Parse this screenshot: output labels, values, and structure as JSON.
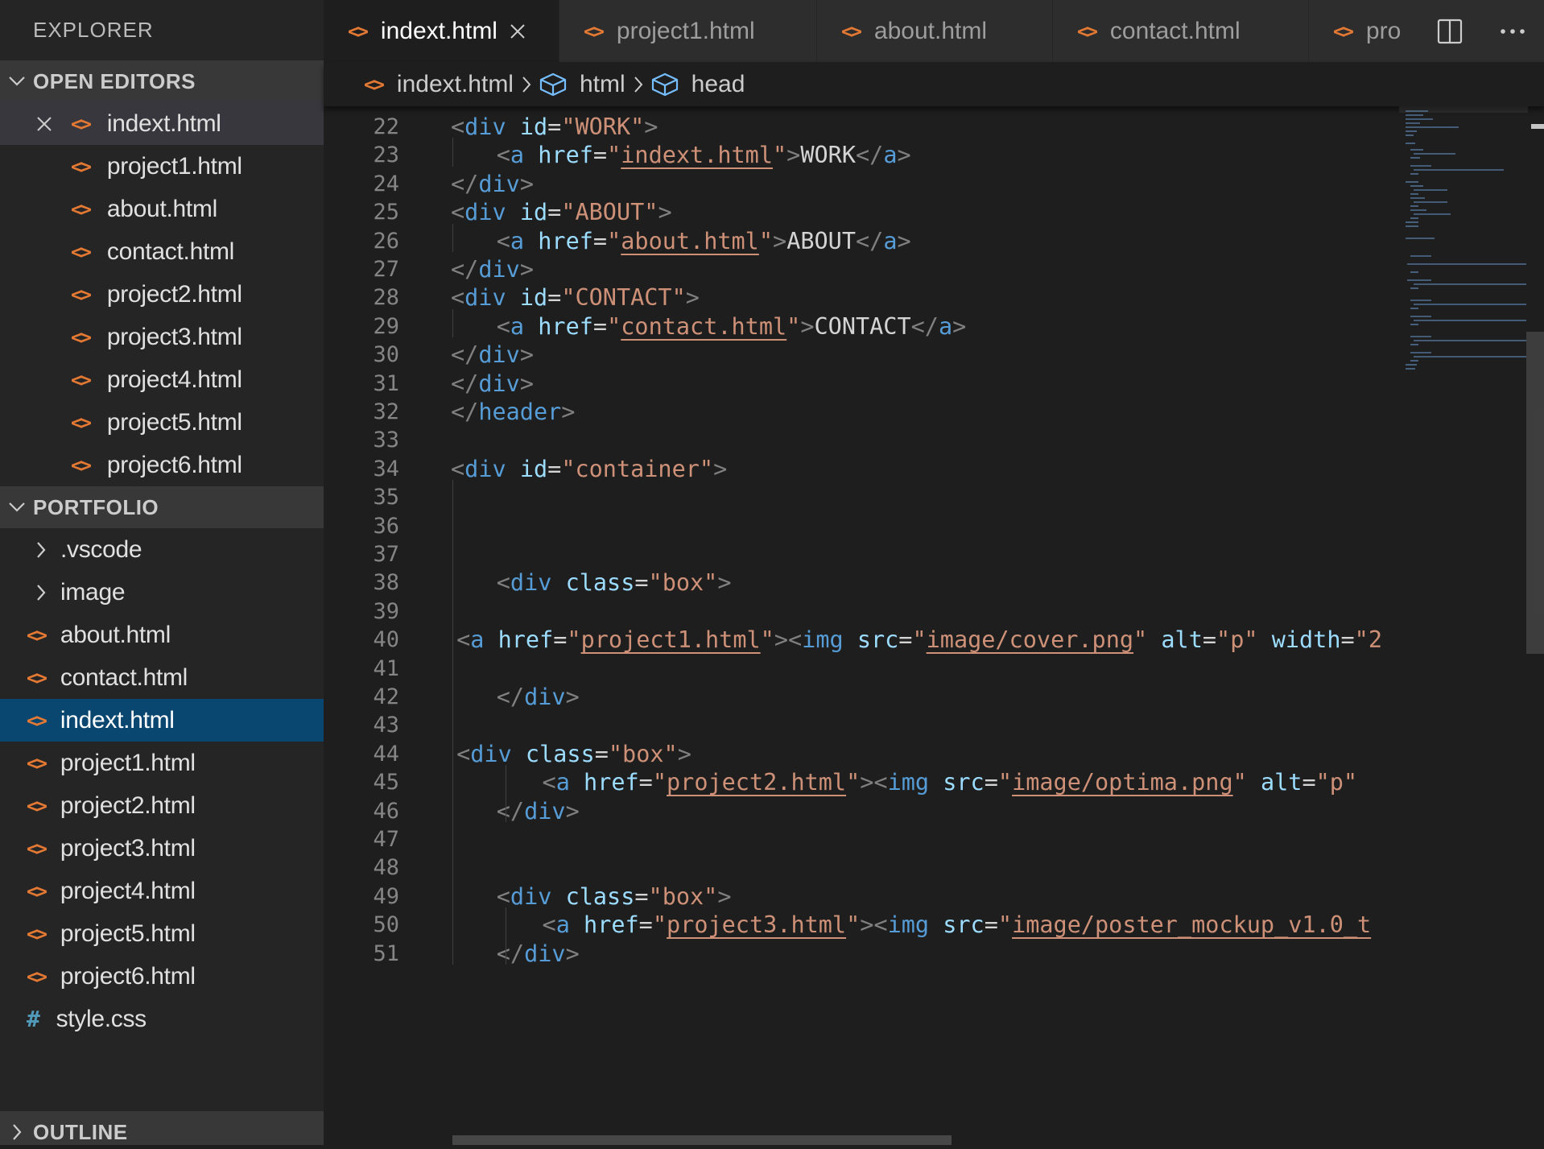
{
  "sidebar": {
    "title": "EXPLORER",
    "open_editors": {
      "label": "OPEN EDITORS",
      "items": [
        {
          "name": "indext.html",
          "active": true
        },
        {
          "name": "project1.html"
        },
        {
          "name": "about.html"
        },
        {
          "name": "contact.html"
        },
        {
          "name": "project2.html"
        },
        {
          "name": "project3.html"
        },
        {
          "name": "project4.html"
        },
        {
          "name": "project5.html"
        },
        {
          "name": "project6.html"
        }
      ]
    },
    "workspace": {
      "label": "PORTFOLIO",
      "folders": [
        ".vscode",
        "image"
      ],
      "files": [
        {
          "name": "about.html",
          "kind": "html"
        },
        {
          "name": "contact.html",
          "kind": "html"
        },
        {
          "name": "indext.html",
          "kind": "html",
          "selected": true
        },
        {
          "name": "project1.html",
          "kind": "html"
        },
        {
          "name": "project2.html",
          "kind": "html"
        },
        {
          "name": "project3.html",
          "kind": "html"
        },
        {
          "name": "project4.html",
          "kind": "html"
        },
        {
          "name": "project5.html",
          "kind": "html"
        },
        {
          "name": "project6.html",
          "kind": "html"
        },
        {
          "name": "style.css",
          "kind": "css"
        }
      ]
    },
    "outline_label": "OUTLINE"
  },
  "tabs": [
    {
      "label": "indext.html",
      "active": true
    },
    {
      "label": "project1.html"
    },
    {
      "label": "about.html"
    },
    {
      "label": "contact.html"
    },
    {
      "label": "pro"
    }
  ],
  "breadcrumb": [
    "indext.html",
    "html",
    "head"
  ],
  "icons": {
    "html_file": "<>",
    "css_file": "#",
    "close": "close-icon",
    "chevron": "chevron-icon",
    "symbol": "cube-icon",
    "split_editor": "split-editor-icon",
    "more_actions": "more-actions-icon"
  },
  "colors": {
    "sidebar_bg": "#252526",
    "editor_bg": "#1e1e1e",
    "selection": "#094771",
    "html_icon": "#e37933",
    "css_icon": "#519aba",
    "tag": "#569cd6",
    "attr": "#9cdcfe",
    "string": "#ce9178"
  },
  "code": [
    {
      "ln": "22",
      "indent": 0,
      "tokens": [
        [
          "punc",
          "<"
        ],
        [
          "tag",
          "div"
        ],
        [
          "text",
          " "
        ],
        [
          "attr",
          "id"
        ],
        [
          "text",
          "="
        ],
        [
          "str",
          "\"WORK\""
        ],
        [
          "punc",
          ">"
        ]
      ]
    },
    {
      "ln": "23",
      "indent": 2,
      "tokens": [
        [
          "punc",
          "<"
        ],
        [
          "tag",
          "a"
        ],
        [
          "text",
          " "
        ],
        [
          "attr",
          "href"
        ],
        [
          "text",
          "="
        ],
        [
          "str",
          "\""
        ],
        [
          "link",
          "indext.html"
        ],
        [
          "str",
          "\""
        ],
        [
          "punc",
          ">"
        ],
        [
          "text",
          "WORK"
        ],
        [
          "punc",
          "</"
        ],
        [
          "tag",
          "a"
        ],
        [
          "punc",
          ">"
        ]
      ]
    },
    {
      "ln": "24",
      "indent": 0,
      "tokens": [
        [
          "punc",
          "</"
        ],
        [
          "tag",
          "div"
        ],
        [
          "punc",
          ">"
        ]
      ]
    },
    {
      "ln": "25",
      "indent": 0,
      "tokens": [
        [
          "punc",
          "<"
        ],
        [
          "tag",
          "div"
        ],
        [
          "text",
          " "
        ],
        [
          "attr",
          "id"
        ],
        [
          "text",
          "="
        ],
        [
          "str",
          "\"ABOUT\""
        ],
        [
          "punc",
          ">"
        ]
      ]
    },
    {
      "ln": "26",
      "indent": 2,
      "tokens": [
        [
          "punc",
          "<"
        ],
        [
          "tag",
          "a"
        ],
        [
          "text",
          " "
        ],
        [
          "attr",
          "href"
        ],
        [
          "text",
          "="
        ],
        [
          "str",
          "\""
        ],
        [
          "link",
          "about.html"
        ],
        [
          "str",
          "\""
        ],
        [
          "punc",
          ">"
        ],
        [
          "text",
          "ABOUT"
        ],
        [
          "punc",
          "</"
        ],
        [
          "tag",
          "a"
        ],
        [
          "punc",
          ">"
        ]
      ]
    },
    {
      "ln": "27",
      "indent": 0,
      "tokens": [
        [
          "punc",
          "</"
        ],
        [
          "tag",
          "div"
        ],
        [
          "punc",
          ">"
        ]
      ]
    },
    {
      "ln": "28",
      "indent": 0,
      "tokens": [
        [
          "punc",
          "<"
        ],
        [
          "tag",
          "div"
        ],
        [
          "text",
          " "
        ],
        [
          "attr",
          "id"
        ],
        [
          "text",
          "="
        ],
        [
          "str",
          "\"CONTACT\""
        ],
        [
          "punc",
          ">"
        ]
      ]
    },
    {
      "ln": "29",
      "indent": 2,
      "tokens": [
        [
          "punc",
          "<"
        ],
        [
          "tag",
          "a"
        ],
        [
          "text",
          " "
        ],
        [
          "attr",
          "href"
        ],
        [
          "text",
          "="
        ],
        [
          "str",
          "\""
        ],
        [
          "link",
          "contact.html"
        ],
        [
          "str",
          "\""
        ],
        [
          "punc",
          ">"
        ],
        [
          "text",
          "CONTACT"
        ],
        [
          "punc",
          "</"
        ],
        [
          "tag",
          "a"
        ],
        [
          "punc",
          ">"
        ]
      ]
    },
    {
      "ln": "30",
      "indent": 0,
      "tokens": [
        [
          "punc",
          "</"
        ],
        [
          "tag",
          "div"
        ],
        [
          "punc",
          ">"
        ]
      ]
    },
    {
      "ln": "31",
      "indent": 0,
      "tokens": [
        [
          "punc",
          "</"
        ],
        [
          "tag",
          "div"
        ],
        [
          "punc",
          ">"
        ]
      ]
    },
    {
      "ln": "32",
      "indent": 0,
      "tokens": [
        [
          "punc",
          "</"
        ],
        [
          "tag",
          "header"
        ],
        [
          "punc",
          ">"
        ]
      ]
    },
    {
      "ln": "33",
      "indent": 0,
      "tokens": []
    },
    {
      "ln": "34",
      "indent": 0,
      "tokens": [
        [
          "punc",
          "<"
        ],
        [
          "tag",
          "div"
        ],
        [
          "text",
          " "
        ],
        [
          "attr",
          "id"
        ],
        [
          "text",
          "="
        ],
        [
          "str",
          "\"container\""
        ],
        [
          "punc",
          ">"
        ]
      ]
    },
    {
      "ln": "35",
      "indent": 0,
      "tokens": []
    },
    {
      "ln": "36",
      "indent": 0,
      "tokens": []
    },
    {
      "ln": "37",
      "indent": 0,
      "tokens": []
    },
    {
      "ln": "38",
      "indent": 2,
      "tokens": [
        [
          "punc",
          "<"
        ],
        [
          "tag",
          "div"
        ],
        [
          "text",
          " "
        ],
        [
          "attr",
          "class"
        ],
        [
          "text",
          "="
        ],
        [
          "str",
          "\"box\""
        ],
        [
          "punc",
          ">"
        ]
      ]
    },
    {
      "ln": "39",
      "indent": 0,
      "tokens": []
    },
    {
      "ln": "40",
      "indent": 0.25,
      "tokens": [
        [
          "punc",
          "<"
        ],
        [
          "tag",
          "a"
        ],
        [
          "text",
          " "
        ],
        [
          "attr",
          "href"
        ],
        [
          "text",
          "="
        ],
        [
          "str",
          "\""
        ],
        [
          "link",
          "project1.html"
        ],
        [
          "str",
          "\""
        ],
        [
          "punc",
          "><"
        ],
        [
          "tag",
          "img"
        ],
        [
          "text",
          " "
        ],
        [
          "attr",
          "src"
        ],
        [
          "text",
          "="
        ],
        [
          "str",
          "\""
        ],
        [
          "link",
          "image/cover.png"
        ],
        [
          "str",
          "\""
        ],
        [
          "text",
          " "
        ],
        [
          "attr",
          "alt"
        ],
        [
          "text",
          "="
        ],
        [
          "str",
          "\"p\""
        ],
        [
          "text",
          " "
        ],
        [
          "attr",
          "width"
        ],
        [
          "text",
          "="
        ],
        [
          "str",
          "\"2"
        ]
      ]
    },
    {
      "ln": "41",
      "indent": 0,
      "tokens": []
    },
    {
      "ln": "42",
      "indent": 2,
      "tokens": [
        [
          "punc",
          "</"
        ],
        [
          "tag",
          "div"
        ],
        [
          "punc",
          ">"
        ]
      ]
    },
    {
      "ln": "43",
      "indent": 0,
      "tokens": []
    },
    {
      "ln": "44",
      "indent": 0.25,
      "tokens": [
        [
          "punc",
          "<"
        ],
        [
          "tag",
          "div"
        ],
        [
          "text",
          " "
        ],
        [
          "attr",
          "class"
        ],
        [
          "text",
          "="
        ],
        [
          "str",
          "\"box\""
        ],
        [
          "punc",
          ">"
        ]
      ]
    },
    {
      "ln": "45",
      "indent": 4,
      "tokens": [
        [
          "punc",
          "<"
        ],
        [
          "tag",
          "a"
        ],
        [
          "text",
          " "
        ],
        [
          "attr",
          "href"
        ],
        [
          "text",
          "="
        ],
        [
          "str",
          "\""
        ],
        [
          "link",
          "project2.html"
        ],
        [
          "str",
          "\""
        ],
        [
          "punc",
          "><"
        ],
        [
          "tag",
          "img"
        ],
        [
          "text",
          " "
        ],
        [
          "attr",
          "src"
        ],
        [
          "text",
          "="
        ],
        [
          "str",
          "\""
        ],
        [
          "link",
          "image/optima.png"
        ],
        [
          "str",
          "\""
        ],
        [
          "text",
          " "
        ],
        [
          "attr",
          "alt"
        ],
        [
          "text",
          "="
        ],
        [
          "str",
          "\"p\""
        ]
      ]
    },
    {
      "ln": "46",
      "indent": 2,
      "tokens": [
        [
          "punc",
          "</"
        ],
        [
          "tag",
          "div"
        ],
        [
          "punc",
          ">"
        ]
      ]
    },
    {
      "ln": "47",
      "indent": 0,
      "tokens": []
    },
    {
      "ln": "48",
      "indent": 0,
      "tokens": []
    },
    {
      "ln": "49",
      "indent": 2,
      "tokens": [
        [
          "punc",
          "<"
        ],
        [
          "tag",
          "div"
        ],
        [
          "text",
          " "
        ],
        [
          "attr",
          "class"
        ],
        [
          "text",
          "="
        ],
        [
          "str",
          "\"box\""
        ],
        [
          "punc",
          ">"
        ]
      ]
    },
    {
      "ln": "50",
      "indent": 4,
      "tokens": [
        [
          "punc",
          "<"
        ],
        [
          "tag",
          "a"
        ],
        [
          "text",
          " "
        ],
        [
          "attr",
          "href"
        ],
        [
          "text",
          "="
        ],
        [
          "str",
          "\""
        ],
        [
          "link",
          "project3.html"
        ],
        [
          "str",
          "\""
        ],
        [
          "punc",
          "><"
        ],
        [
          "tag",
          "img"
        ],
        [
          "text",
          " "
        ],
        [
          "attr",
          "src"
        ],
        [
          "text",
          "="
        ],
        [
          "str",
          "\""
        ],
        [
          "link",
          "image/poster_mockup_v1.0_t"
        ]
      ]
    },
    {
      "ln": "51",
      "indent": 2,
      "tokens": [
        [
          "punc",
          "</"
        ],
        [
          "tag",
          "div"
        ],
        [
          "punc",
          ">"
        ]
      ]
    }
  ]
}
